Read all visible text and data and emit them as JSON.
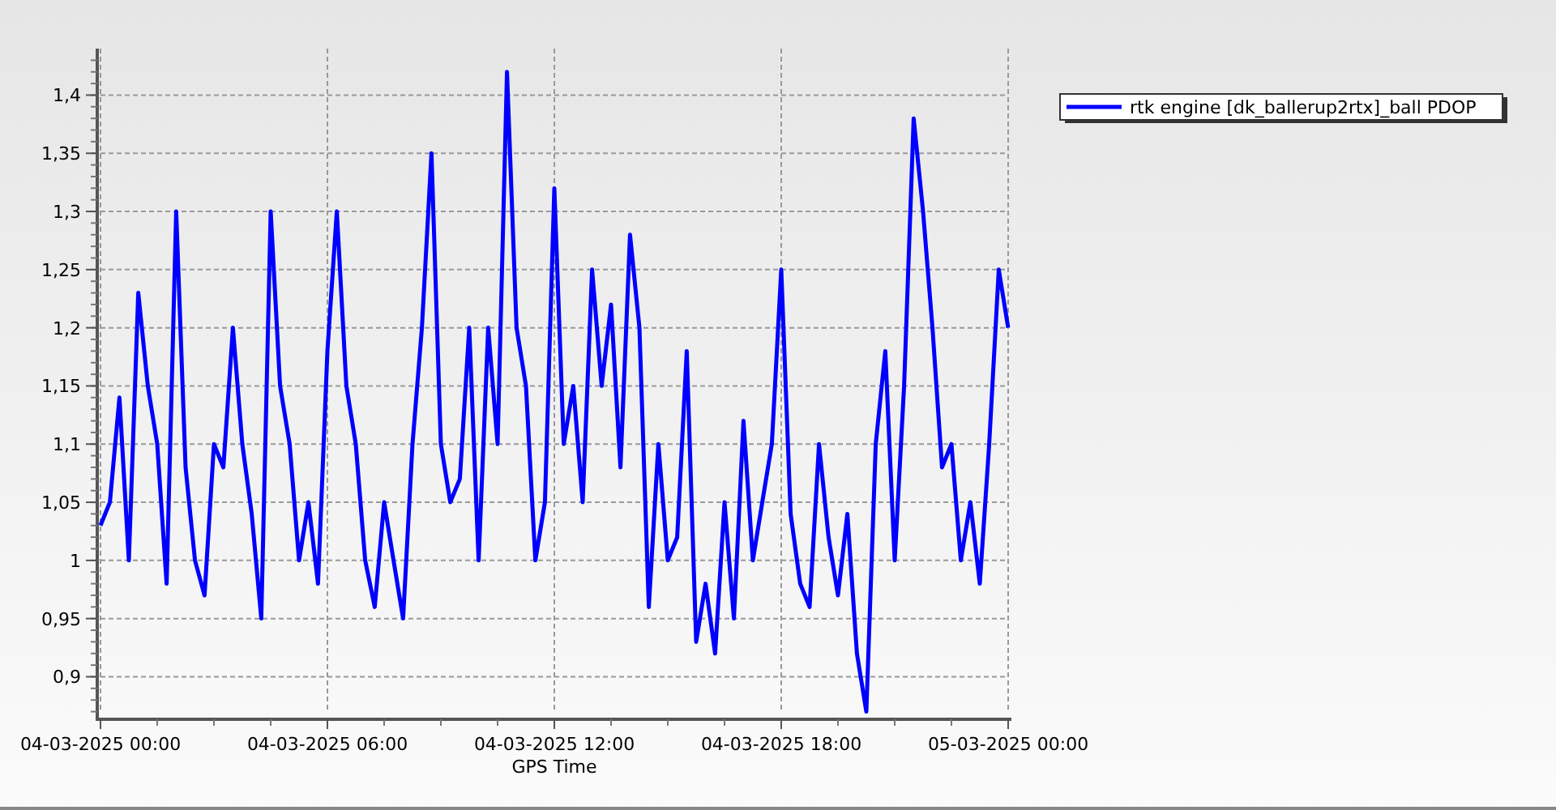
{
  "chart": {
    "chart_data": {
      "type": "line",
      "xlabel": "GPS Time",
      "grid": true,
      "ylim": [
        0.869,
        1.44
      ],
      "yticks": [
        {
          "value": 0.9,
          "label": "0,9"
        },
        {
          "value": 0.95,
          "label": "0,95"
        },
        {
          "value": 1,
          "label": "1"
        },
        {
          "value": 1.05,
          "label": "1,05"
        },
        {
          "value": 1.1,
          "label": "1,1"
        },
        {
          "value": 1.15,
          "label": "1,15"
        },
        {
          "value": 1.2,
          "label": "1,2"
        },
        {
          "value": 1.25,
          "label": "1,25"
        },
        {
          "value": 1.3,
          "label": "1,3"
        },
        {
          "value": 1.35,
          "label": "1,35"
        },
        {
          "value": 1.4,
          "label": "1,4"
        }
      ],
      "categories": [
        "04-03-2025 00:00",
        null,
        null,
        null,
        null,
        null,
        null,
        null,
        null,
        null,
        null,
        null,
        null,
        null,
        null,
        null,
        null,
        null,
        null,
        null,
        null,
        null,
        null,
        null,
        "04-03-2025 06:00",
        null,
        null,
        null,
        null,
        null,
        null,
        null,
        null,
        null,
        null,
        null,
        null,
        null,
        null,
        null,
        null,
        null,
        null,
        null,
        null,
        null,
        null,
        null,
        "04-03-2025 12:00",
        null,
        null,
        null,
        null,
        null,
        null,
        null,
        null,
        null,
        null,
        null,
        null,
        null,
        null,
        null,
        null,
        null,
        null,
        null,
        null,
        null,
        null,
        null,
        "04-03-2025 18:00",
        null,
        null,
        null,
        null,
        null,
        null,
        null,
        null,
        null,
        null,
        null,
        null,
        null,
        null,
        null,
        null,
        null,
        null,
        null,
        null,
        null,
        null,
        null,
        "05-03-2025 00:00"
      ],
      "series": [
        {
          "name": "rtk engine [dk_ballerup2rtx]_ball PDOP",
          "color": "#0000ff",
          "values": [
            1.03,
            1.05,
            1.14,
            1.0,
            1.23,
            1.15,
            1.1,
            0.98,
            1.3,
            1.08,
            1.0,
            0.97,
            1.1,
            1.08,
            1.2,
            1.1,
            1.04,
            0.95,
            1.3,
            1.15,
            1.1,
            1.0,
            1.05,
            0.98,
            1.18,
            1.3,
            1.15,
            1.1,
            1.0,
            0.96,
            1.05,
            1.0,
            0.95,
            1.1,
            1.2,
            1.35,
            1.1,
            1.05,
            1.07,
            1.2,
            1.0,
            1.2,
            1.1,
            1.42,
            1.2,
            1.15,
            1.0,
            1.05,
            1.32,
            1.1,
            1.15,
            1.05,
            1.25,
            1.15,
            1.22,
            1.08,
            1.28,
            1.2,
            0.96,
            1.1,
            1.0,
            1.02,
            1.18,
            0.93,
            0.98,
            0.92,
            1.05,
            0.95,
            1.12,
            1.0,
            1.05,
            1.1,
            1.25,
            1.04,
            0.98,
            0.96,
            1.1,
            1.02,
            0.97,
            1.04,
            0.92,
            0.87,
            1.1,
            1.18,
            1.0,
            1.15,
            1.38,
            1.3,
            1.2,
            1.08,
            1.1,
            1.0,
            1.05,
            0.98,
            1.1,
            1.25,
            1.2
          ]
        }
      ]
    }
  }
}
